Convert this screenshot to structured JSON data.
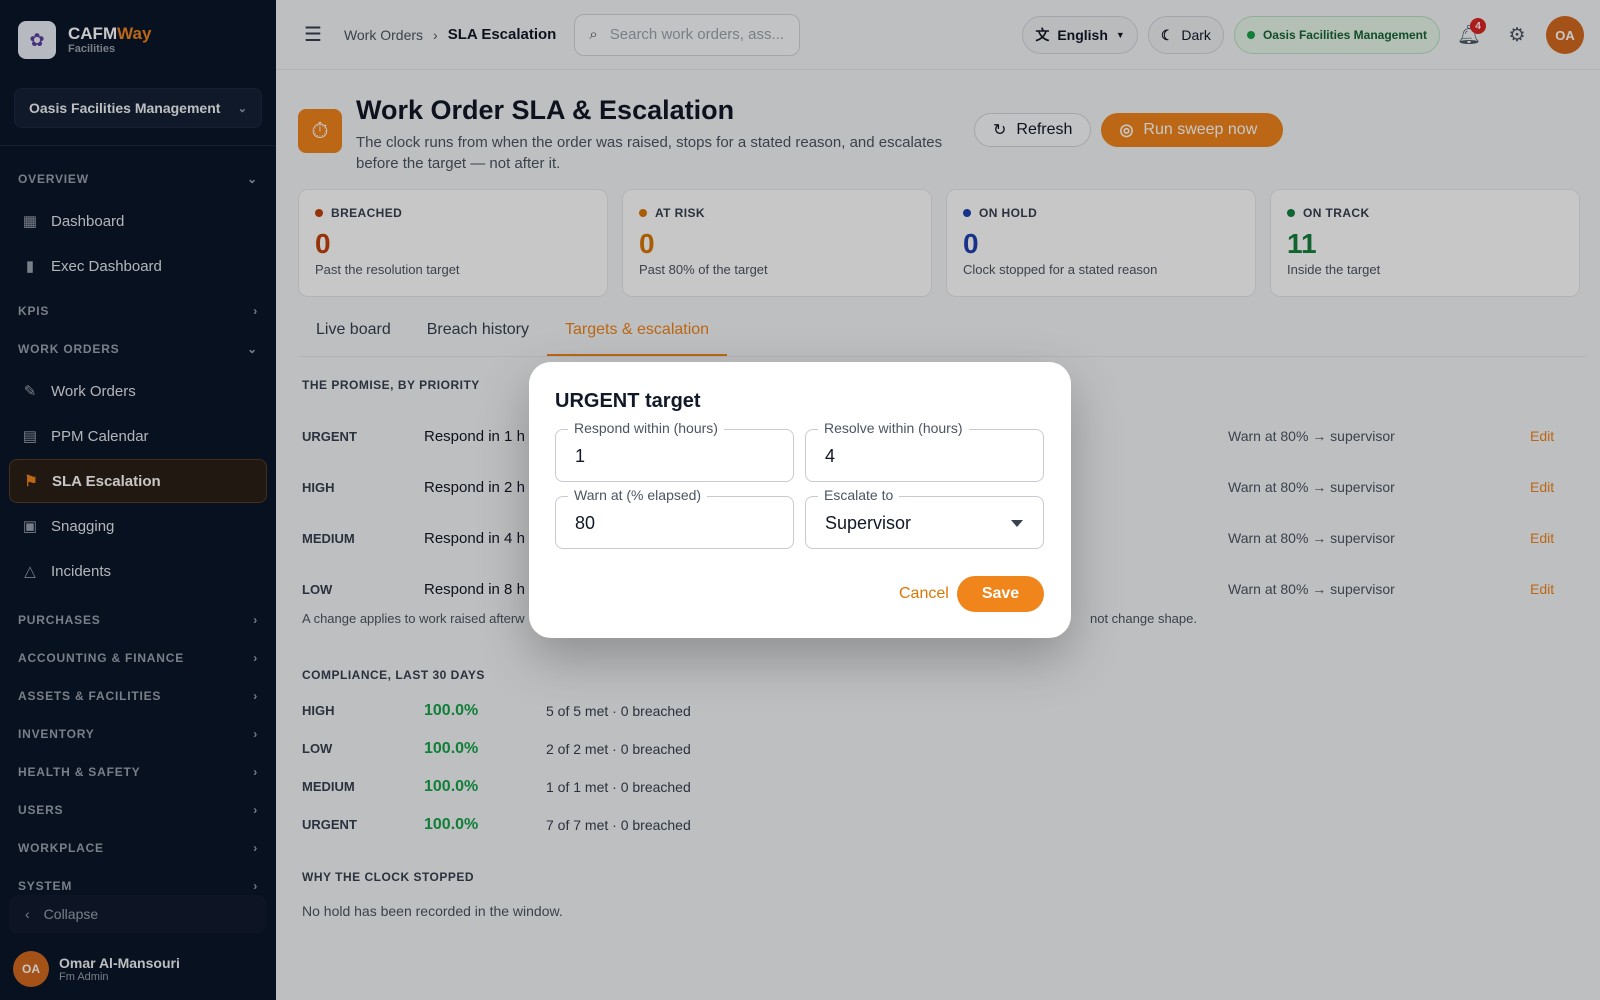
{
  "brand": {
    "name_main": "CAFM",
    "name_accent": "Way",
    "sub": "Facilities"
  },
  "sidebar": {
    "org": "Oasis Facilities Management",
    "sections": {
      "overview": "OVERVIEW",
      "kpis": "KPIS",
      "work_orders": "WORK ORDERS",
      "purchases": "PURCHASES",
      "accounting": "ACCOUNTING & FINANCE",
      "assets": "ASSETS & FACILITIES",
      "inventory": "INVENTORY",
      "health": "HEALTH & SAFETY",
      "users": "USERS",
      "workplace": "WORKPLACE",
      "system": "SYSTEM"
    },
    "items": {
      "dashboard": "Dashboard",
      "exec_dashboard": "Exec Dashboard",
      "work_orders": "Work Orders",
      "ppm_calendar": "PPM Calendar",
      "sla_escalation": "SLA Escalation",
      "snagging": "Snagging",
      "incidents": "Incidents"
    },
    "collapse": "Collapse",
    "user": {
      "initials": "OA",
      "name": "Omar Al-Mansouri",
      "role": "Fm Admin"
    }
  },
  "topbar": {
    "breadcrumb_parent": "Work Orders",
    "breadcrumb_current": "SLA Escalation",
    "search_placeholder": "Search work orders, ass...",
    "language": "English",
    "theme": "Dark",
    "org_badge": "Oasis Facilities Management",
    "notifications": "4",
    "avatar": "OA"
  },
  "page": {
    "title": "Work Order SLA & Escalation",
    "subtitle": "The clock runs from when the order was raised, stops for a stated reason, and escalates before the target — not after it.",
    "refresh": "Refresh",
    "run_sweep": "Run sweep now"
  },
  "stats": [
    {
      "label": "BREACHED",
      "value": "0",
      "desc": "Past the resolution target",
      "color": "#c2410c"
    },
    {
      "label": "AT RISK",
      "value": "0",
      "desc": "Past 80% of the target",
      "color": "#d97706"
    },
    {
      "label": "ON HOLD",
      "value": "0",
      "desc": "Clock stopped for a stated reason",
      "color": "#1e40af"
    },
    {
      "label": "ON TRACK",
      "value": "11",
      "desc": "Inside the target",
      "color": "#15803d"
    }
  ],
  "tabs": [
    "Live board",
    "Breach history",
    "Targets & escalation"
  ],
  "promise": {
    "title": "THE PROMISE, BY PRIORITY",
    "rows": [
      {
        "name": "URGENT",
        "respond": "Respond in 1 h ·",
        "warn": "Warn at 80% → supervisor",
        "edit": "Edit"
      },
      {
        "name": "HIGH",
        "respond": "Respond in 2 h ·",
        "warn": "Warn at 80% → supervisor",
        "edit": "Edit"
      },
      {
        "name": "MEDIUM",
        "respond": "Respond in 4 h ·",
        "warn": "Warn at 80% → supervisor",
        "edit": "Edit"
      },
      {
        "name": "LOW",
        "respond": "Respond in 8 h ·",
        "warn": "Warn at 80% → supervisor",
        "edit": "Edit"
      }
    ],
    "note_left": "A change applies to work raised afterw",
    "note_right": "not change shape."
  },
  "compliance": {
    "title": "COMPLIANCE, LAST 30 DAYS",
    "rows": [
      {
        "name": "HIGH",
        "pct": "100.0%",
        "met": "5 of 5 met · 0 breached"
      },
      {
        "name": "LOW",
        "pct": "100.0%",
        "met": "2 of 2 met · 0 breached"
      },
      {
        "name": "MEDIUM",
        "pct": "100.0%",
        "met": "1 of 1 met · 0 breached"
      },
      {
        "name": "URGENT",
        "pct": "100.0%",
        "met": "7 of 7 met · 0 breached"
      }
    ]
  },
  "hold": {
    "title": "WHY THE CLOCK STOPPED",
    "text": "No hold has been recorded in the window."
  },
  "dialog": {
    "title": "URGENT target",
    "respond_label": "Respond within (hours)",
    "respond_value": "1",
    "resolve_label": "Resolve within (hours)",
    "resolve_value": "4",
    "warn_label": "Warn at (% elapsed)",
    "warn_value": "80",
    "escalate_label": "Escalate to",
    "escalate_value": "Supervisor",
    "cancel": "Cancel",
    "save": "Save"
  }
}
